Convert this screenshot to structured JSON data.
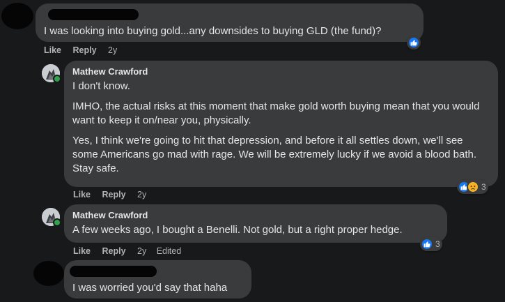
{
  "comments": [
    {
      "author": "",
      "paragraphs": [
        "I was looking into buying gold...any downsides to buying GLD (the fund)?"
      ],
      "actions": {
        "like": "Like",
        "reply": "Reply",
        "time": "2y"
      },
      "reactions": {
        "types": [
          "like"
        ],
        "count": ""
      }
    },
    {
      "author": "Mathew Crawford",
      "paragraphs": [
        "I don't know.",
        "IMHO, the actual risks at this moment that make gold worth buying mean that you would want to keep it on/near you, physically.",
        "Yes, I think we're going to hit that depression, and before it all settles down, we'll see some Americans go mad with rage. We will be extremely lucky if we avoid a blood bath. Stay safe."
      ],
      "actions": {
        "like": "Like",
        "reply": "Reply",
        "time": "2y"
      },
      "reactions": {
        "types": [
          "like",
          "sad"
        ],
        "count": "3"
      }
    },
    {
      "author": "Mathew Crawford",
      "paragraphs": [
        "A few weeks ago, I bought a Benelli. Not gold, but a right proper hedge."
      ],
      "actions": {
        "like": "Like",
        "reply": "Reply",
        "time": "2y",
        "edited": "Edited"
      },
      "reactions": {
        "types": [
          "like"
        ],
        "count": "3"
      }
    },
    {
      "author": "",
      "paragraphs": [
        "I was worried you'd say that haha"
      ]
    }
  ],
  "colors": {
    "background": "#18191a",
    "bubble": "#3a3b3c",
    "text": "#e4e6eb",
    "secondary_text": "#b0b3b8",
    "like_blue": "#1877f2",
    "sad_yellow": "#f7b125",
    "online_green": "#31a24c"
  },
  "icons": [
    "like-reaction-icon",
    "sad-reaction-icon",
    "avatar",
    "online-status-icon"
  ]
}
